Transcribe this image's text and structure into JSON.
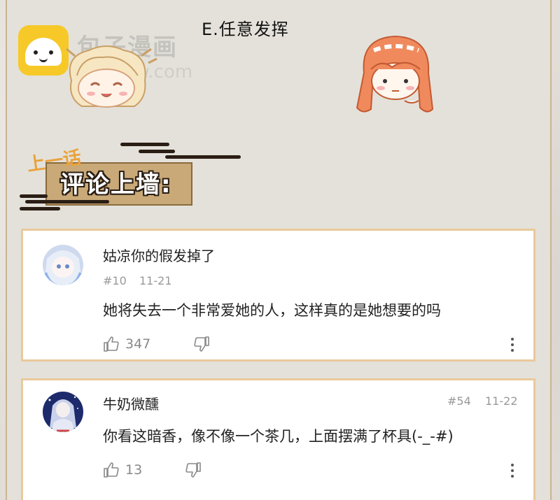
{
  "header": {
    "option_text": "E.任意发挥",
    "watermark": "包子漫画",
    "watermark_url": "www.com",
    "banner_kicker": "上一话",
    "banner_title": "评论上墙:"
  },
  "comments": [
    {
      "username": "姑凉你的假发掉了",
      "floor": "#10",
      "date": "11-21",
      "text": "她将失去一个非常爱她的人，这样真的是她想要的吗",
      "likes": "347",
      "like_icon": "thumbs-up-icon",
      "dislike_icon": "thumbs-down-icon",
      "more_icon": "more-vertical-icon"
    },
    {
      "username": "牛奶微醺",
      "floor": "#54",
      "date": "11-22",
      "text": "你看这暗香，像不像一个茶几，上面摆满了杯具(-_-#)",
      "likes": "13",
      "like_icon": "thumbs-up-icon",
      "dislike_icon": "thumbs-down-icon",
      "more_icon": "more-vertical-icon"
    }
  ],
  "colors": {
    "card_border": "#e9c99b",
    "banner_kicker": "#e9a23b",
    "logo_yellow": "#f6c928"
  }
}
